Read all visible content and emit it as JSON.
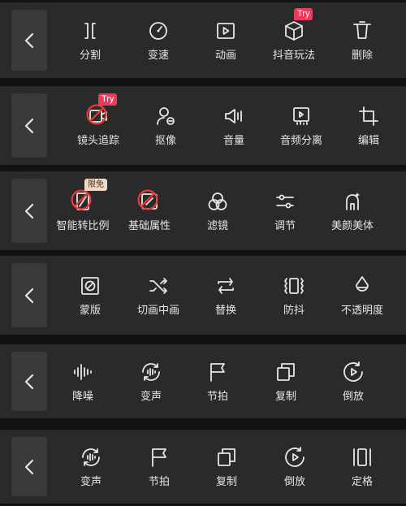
{
  "rows": [
    {
      "tools": [
        {
          "label": "分割",
          "icon": "split-icon"
        },
        {
          "label": "变速",
          "icon": "speed-icon"
        },
        {
          "label": "动画",
          "icon": "animation-icon"
        },
        {
          "label": "抖音玩法",
          "icon": "douyin-effects-icon",
          "badge": "Try"
        },
        {
          "label": "删除",
          "icon": "delete-icon"
        }
      ]
    },
    {
      "tools": [
        {
          "label": "镜头追踪",
          "icon": "camera-tracking-icon",
          "badge": "Try",
          "blocked": true
        },
        {
          "label": "抠像",
          "icon": "cutout-icon"
        },
        {
          "label": "音量",
          "icon": "volume-icon"
        },
        {
          "label": "音频分离",
          "icon": "audio-separate-icon"
        },
        {
          "label": "编辑",
          "icon": "crop-icon"
        }
      ]
    },
    {
      "tools": [
        {
          "label": "智能转比例",
          "icon": "smart-ratio-icon",
          "badge": "限免",
          "blocked": true
        },
        {
          "label": "基础属性",
          "icon": "basic-properties-icon",
          "blocked": true
        },
        {
          "label": "滤镜",
          "icon": "filter-icon"
        },
        {
          "label": "调节",
          "icon": "adjust-icon"
        },
        {
          "label": "美颜美体",
          "icon": "beauty-icon"
        }
      ]
    },
    {
      "tools": [
        {
          "label": "蒙版",
          "icon": "mask-icon"
        },
        {
          "label": "切画中画",
          "icon": "shuffle-icon"
        },
        {
          "label": "替换",
          "icon": "replace-icon"
        },
        {
          "label": "防抖",
          "icon": "stabilize-icon"
        },
        {
          "label": "不透明度",
          "icon": "opacity-icon"
        }
      ]
    },
    {
      "tools": [
        {
          "label": "降噪",
          "icon": "noise-reduction-icon"
        },
        {
          "label": "变声",
          "icon": "voice-change-icon"
        },
        {
          "label": "节拍",
          "icon": "beat-flag-icon"
        },
        {
          "label": "复制",
          "icon": "copy-icon"
        },
        {
          "label": "倒放",
          "icon": "reverse-icon"
        }
      ]
    },
    {
      "tools": [
        {
          "label": "变声",
          "icon": "voice-change-icon"
        },
        {
          "label": "节拍",
          "icon": "beat-flag-icon"
        },
        {
          "label": "复制",
          "icon": "copy-icon"
        },
        {
          "label": "倒放",
          "icon": "reverse-icon"
        },
        {
          "label": "定格",
          "icon": "freeze-frame-icon"
        }
      ]
    }
  ]
}
